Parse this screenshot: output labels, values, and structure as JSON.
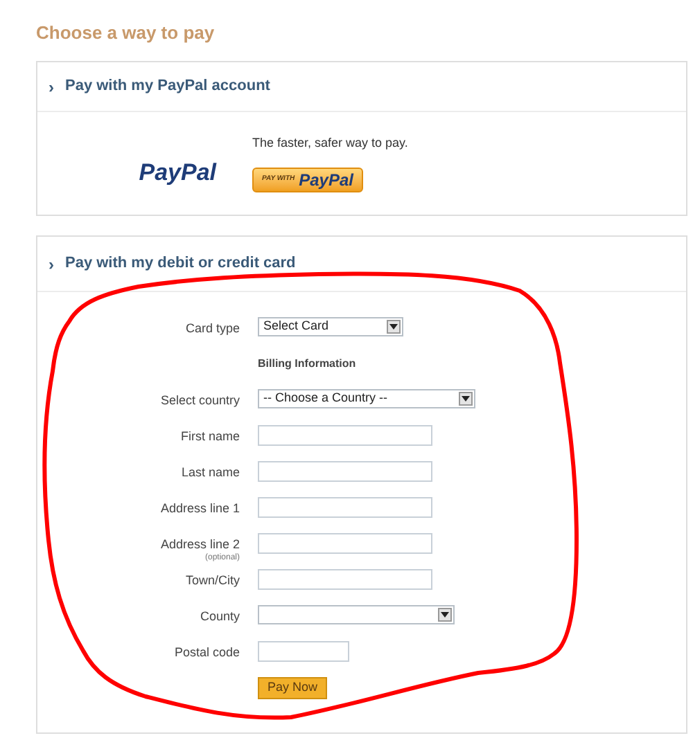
{
  "heading": "Choose a way to pay",
  "paypal_section": {
    "toggle": "›",
    "title": "Pay with my PayPal account",
    "logo": "PayPal",
    "tagline": "The faster, safer way to pay.",
    "button": {
      "prefix": "PAY WITH",
      "brand": "PayPal"
    }
  },
  "card_section": {
    "toggle": "›",
    "title": "Pay with my debit or credit card",
    "fields": [
      {
        "kind": "select",
        "label": "Card type",
        "value": "Select Card"
      },
      {
        "kind": "heading",
        "label": "Billing Information"
      },
      {
        "kind": "select",
        "label": "Select country",
        "value": "-- Choose a Country --"
      },
      {
        "kind": "text",
        "label": "First name"
      },
      {
        "kind": "text",
        "label": "Last name"
      },
      {
        "kind": "text",
        "label": "Address line 1"
      },
      {
        "kind": "text",
        "label": "Address line 2",
        "note": "(optional)"
      },
      {
        "kind": "text",
        "label": "Town/City"
      },
      {
        "kind": "select",
        "label": "County"
      },
      {
        "kind": "text",
        "label": "Postal code"
      }
    ],
    "submit": "Pay Now"
  }
}
